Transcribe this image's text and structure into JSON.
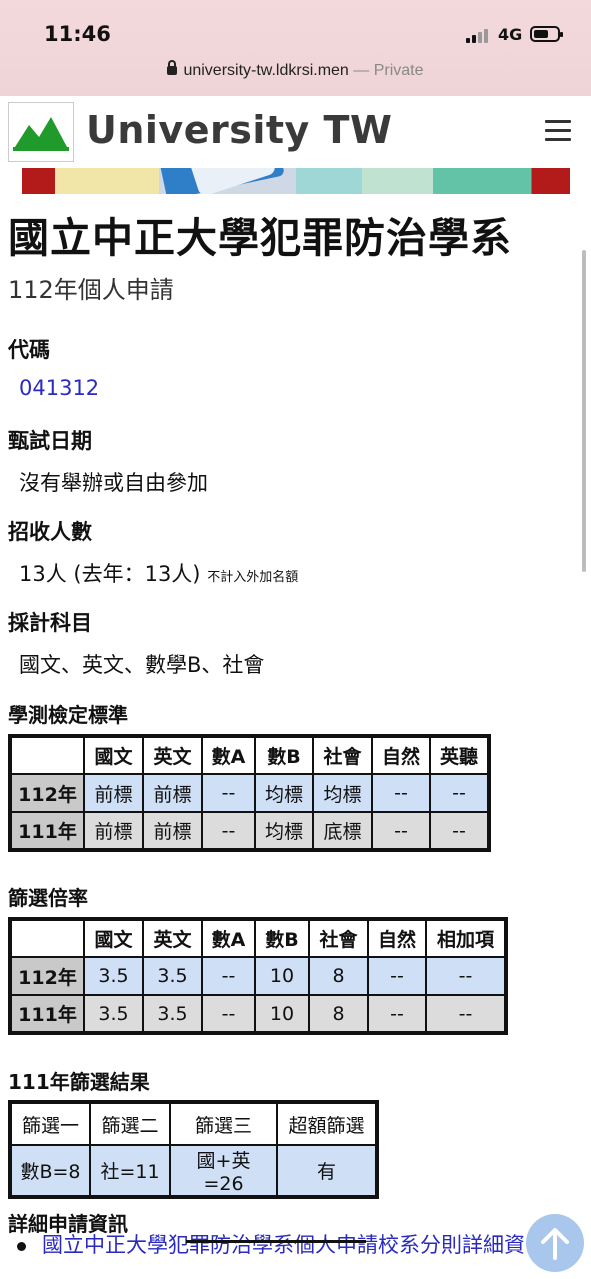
{
  "status": {
    "time": "11:46",
    "network": "4G"
  },
  "browser": {
    "url": "university-tw.ldkrsi.men",
    "privacy": "— Private"
  },
  "site": {
    "brand": "University TW"
  },
  "page": {
    "title": "國立中正大學犯罪防治學系",
    "subtitle": "112年個人申請",
    "code_label": "代碼",
    "code_value": "041312",
    "exam_date_label": "甄試日期",
    "exam_date_value": "沒有舉辦或自由參加",
    "enrollment_label": "招收人數",
    "enrollment_value": "13人 (去年：13人)",
    "enrollment_note": "不計入外加名額",
    "subjects_label": "採計科目",
    "subjects_value": "國文、英文、數學B、社會"
  },
  "standards": {
    "label": "學測檢定標準",
    "headers": [
      "",
      "國文",
      "英文",
      "數A",
      "數B",
      "社會",
      "自然",
      "英聽"
    ],
    "rows": [
      {
        "year": "112年",
        "cells": [
          "前標",
          "前標",
          "--",
          "均標",
          "均標",
          "--",
          "--"
        ]
      },
      {
        "year": "111年",
        "cells": [
          "前標",
          "前標",
          "--",
          "均標",
          "底標",
          "--",
          "--"
        ]
      }
    ]
  },
  "ratio": {
    "label": "篩選倍率",
    "headers": [
      "",
      "國文",
      "英文",
      "數A",
      "數B",
      "社會",
      "自然",
      "相加項"
    ],
    "rows": [
      {
        "year": "112年",
        "cells": [
          "3.5",
          "3.5",
          "--",
          "10",
          "8",
          "--",
          "--"
        ]
      },
      {
        "year": "111年",
        "cells": [
          "3.5",
          "3.5",
          "--",
          "10",
          "8",
          "--",
          "--"
        ]
      }
    ]
  },
  "results": {
    "label": "111年篩選結果",
    "headers": [
      "篩選一",
      "篩選二",
      "篩選三",
      "超額篩選"
    ],
    "values": [
      "數B=8",
      "社=11",
      "國+英=26",
      "有"
    ]
  },
  "details": {
    "label": "詳細申請資訊",
    "link": "國立中正大學犯罪防治學系個人申請校系分則詳細資"
  }
}
